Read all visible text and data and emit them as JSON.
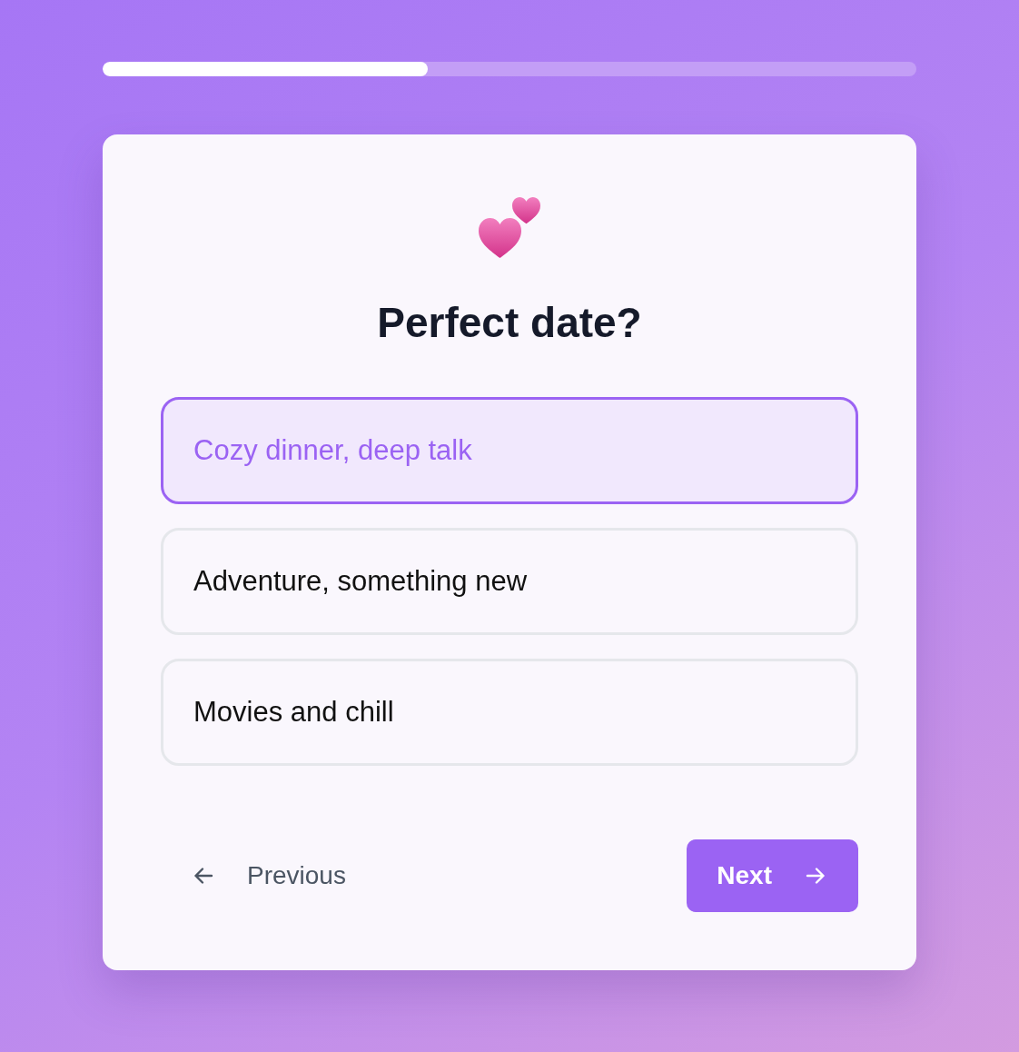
{
  "progress": {
    "level": 0.4
  },
  "question": {
    "title": "Perfect date?"
  },
  "options": [
    {
      "label": "Cozy dinner, deep talk",
      "selected": true
    },
    {
      "label": "Adventure, something new",
      "selected": false
    },
    {
      "label": "Movies and chill",
      "selected": false
    }
  ],
  "nav": {
    "previous": {
      "label": "Previous"
    },
    "next": {
      "label": "Next"
    }
  }
}
